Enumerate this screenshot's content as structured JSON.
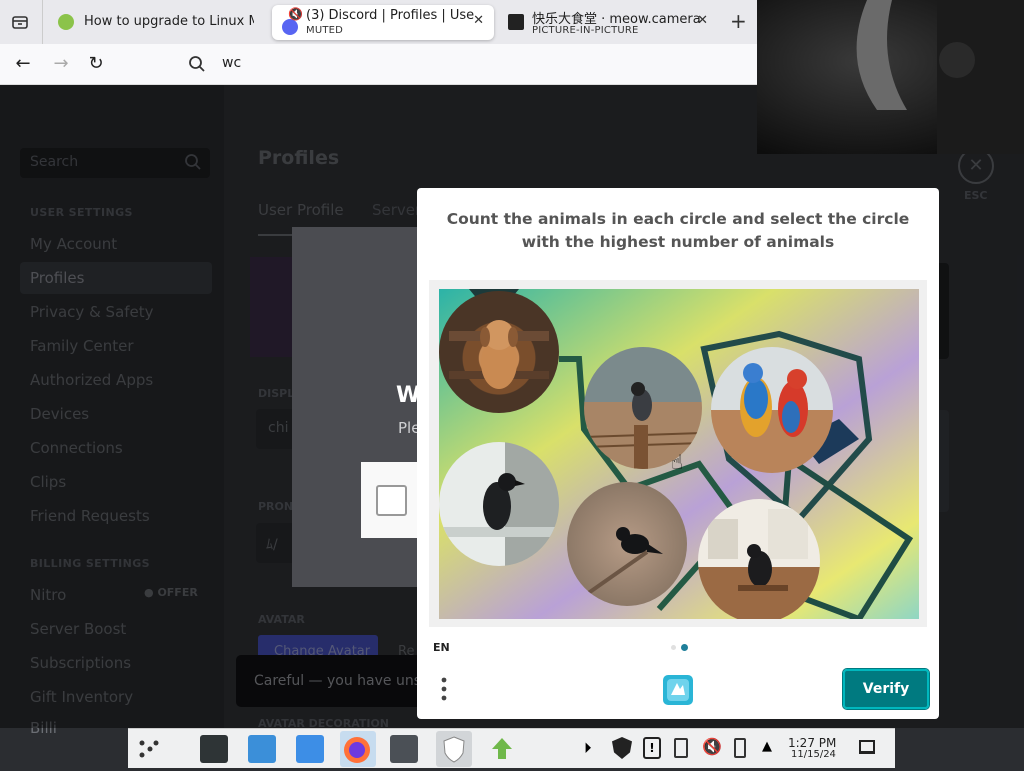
{
  "browser": {
    "tabs": [
      {
        "title": "How to upgrade to Linux M",
        "subtitle": ""
      },
      {
        "title": "(3) Discord | Profiles | Use",
        "subtitle": "MUTED"
      },
      {
        "title": "快乐大食堂 · meow.camera",
        "subtitle": "PICTURE-IN-PICTURE"
      }
    ],
    "new_tab": "+",
    "address": "wc"
  },
  "discord": {
    "search_placeholder": "Search",
    "user_settings_header": "USER SETTINGS",
    "billing_settings_header": "BILLING SETTINGS",
    "sidebar_items": [
      "My Account",
      "Profiles",
      "Privacy & Safety",
      "Family Center",
      "Authorized Apps",
      "Devices",
      "Connections",
      "Clips",
      "Friend Requests"
    ],
    "billing_items": [
      "Nitro",
      "Server Boost",
      "Subscriptions",
      "Gift Inventory",
      "Billi"
    ],
    "offer_badge": "OFFER",
    "page_title": "Profiles",
    "tab_user_profile": "User Profile",
    "tab_server": "Server",
    "display_label": "DISPL",
    "display_value": "chi",
    "pronouns_label": "PRON",
    "pronouns_value": "ﾑ/",
    "avatar_label": "AVATAR",
    "change_avatar": "Change Avatar",
    "remove_avatar": "Re",
    "avatar_decoration": "AVATAR DECORATION",
    "esc_label": "ESC",
    "dialog_title": "W",
    "dialog_sub": "Ple",
    "careful_text": "Careful — you have unsa"
  },
  "captcha": {
    "prompt": "Count the animals in each circle and select the circle with the highest number of animals",
    "lang": "EN",
    "verify_label": "Verify"
  },
  "taskbar": {
    "time": "1:27 PM",
    "date": "11/15/24"
  },
  "colors": {
    "verify_bg": "#007a80",
    "discord_bg": "#323338",
    "sidebar_bg": "#2b2d31"
  }
}
